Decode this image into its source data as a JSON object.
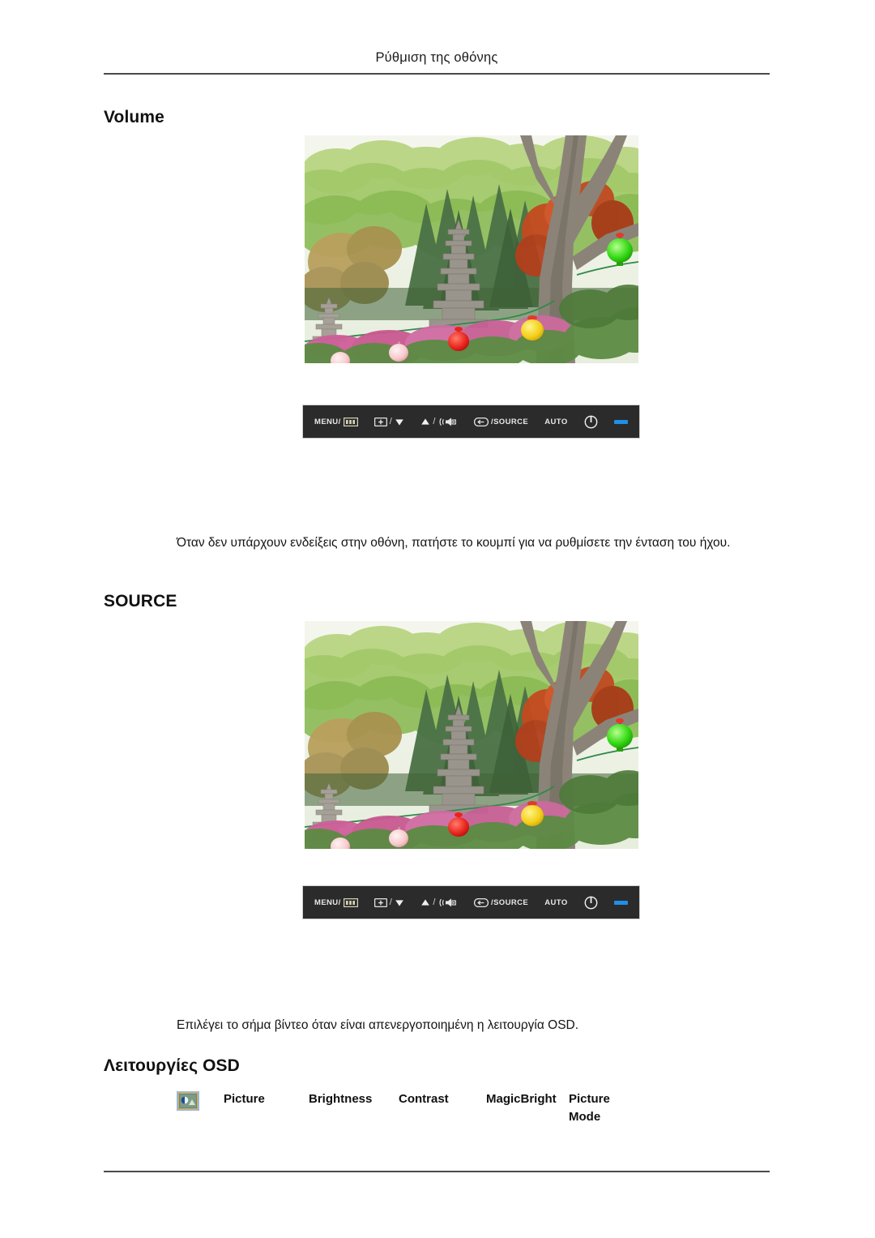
{
  "document": {
    "running_header": "Ρύθμιση της οθόνης"
  },
  "sections": {
    "volume": {
      "heading": "Volume",
      "paragraph": "Όταν δεν υπάρχουν ενδείξεις στην οθόνη, πατήστε το κουμπί για να ρυθμίσετε την ένταση του ήχου."
    },
    "source": {
      "heading": "SOURCE",
      "paragraph": "Επιλέγει το σήμα βίντεο όταν είναι απενεργοποιημένη η λειτουργία OSD."
    },
    "osd": {
      "heading": "Λειτουργίες OSD"
    }
  },
  "control_bar": {
    "buttons": [
      {
        "label": "MENU/",
        "icon": "osd-menu-icon"
      },
      {
        "label": "/",
        "icon": "enter-down-icon",
        "left_icon": "enter-icon",
        "right_icon": "down-arrow-icon"
      },
      {
        "label": "/",
        "icon": "up-volume-icon",
        "left_icon": "up-arrow-icon",
        "right_icon": "speaker-icon"
      },
      {
        "label": "/SOURCE",
        "icon": "source-enter-icon"
      },
      {
        "label": "AUTO",
        "icon": "auto-label"
      },
      {
        "label": "",
        "icon": "power-icon"
      },
      {
        "label": "",
        "icon": "power-led-indicator"
      }
    ],
    "menu_label": "MENU/",
    "separator": "/",
    "source_label": "/SOURCE",
    "auto_label": "AUTO",
    "led_color": "#1f8fe8",
    "bar_color": "#2b2b2b"
  },
  "osd_table": {
    "icon_name": "picture-icon",
    "columns": [
      "Picture",
      "Brightness",
      "Contrast",
      "MagicBright",
      "Picture\nMode"
    ],
    "cells": {
      "picture": "Picture",
      "brightness": "Brightness",
      "contrast": "Contrast",
      "magicbright": "MagicBright",
      "picture_mode": "Picture\nMode"
    }
  },
  "photo": {
    "alt": "Κήπος με πέτρινες παγόδες και χρωματιστά φαναράκια",
    "lanterns": [
      "red",
      "yellow",
      "green",
      "pink"
    ]
  }
}
